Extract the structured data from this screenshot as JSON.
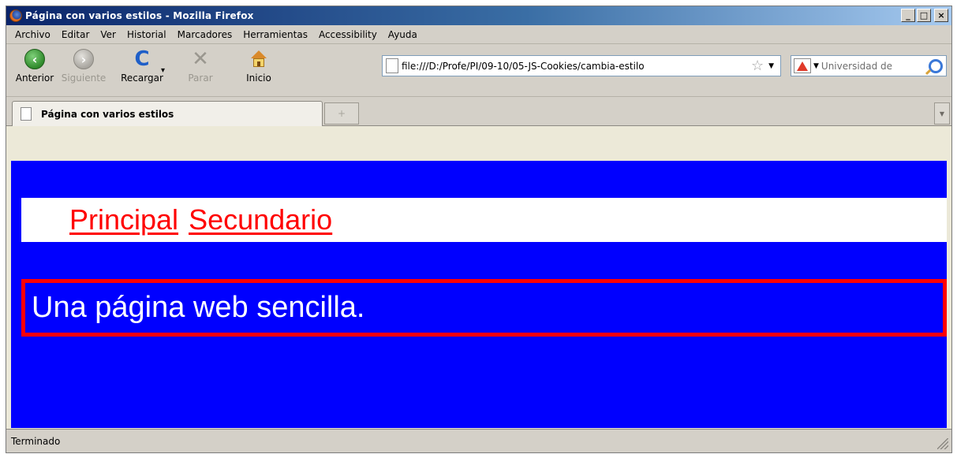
{
  "window": {
    "title": "Página con varios estilos - Mozilla Firefox",
    "controls": {
      "minimize": "_",
      "maximize": "□",
      "close": "×"
    }
  },
  "menubar": {
    "items": [
      "Archivo",
      "Editar",
      "Ver",
      "Historial",
      "Marcadores",
      "Herramientas",
      "Accessibility",
      "Ayuda"
    ]
  },
  "toolbar": {
    "back_label": "Anterior",
    "forward_label": "Siguiente",
    "reload_label": "Recargar",
    "stop_label": "Parar",
    "home_label": "Inicio"
  },
  "urlbar": {
    "value": "file:///D:/Profe/PI/09-10/05-JS-Cookies/cambia-estilo"
  },
  "searchbar": {
    "placeholder": "Universidad de"
  },
  "tabs": {
    "active_title": "Página con varios estilos",
    "newtab_symbol": "+"
  },
  "page": {
    "links": [
      "Principal",
      "Secundario"
    ],
    "main_text": "Una página web sencilla."
  },
  "statusbar": {
    "text": "Terminado"
  },
  "colors": {
    "page_background": "#0000ff",
    "link": "#ff0000",
    "border": "#ff0000",
    "main_text": "#ffffff"
  }
}
